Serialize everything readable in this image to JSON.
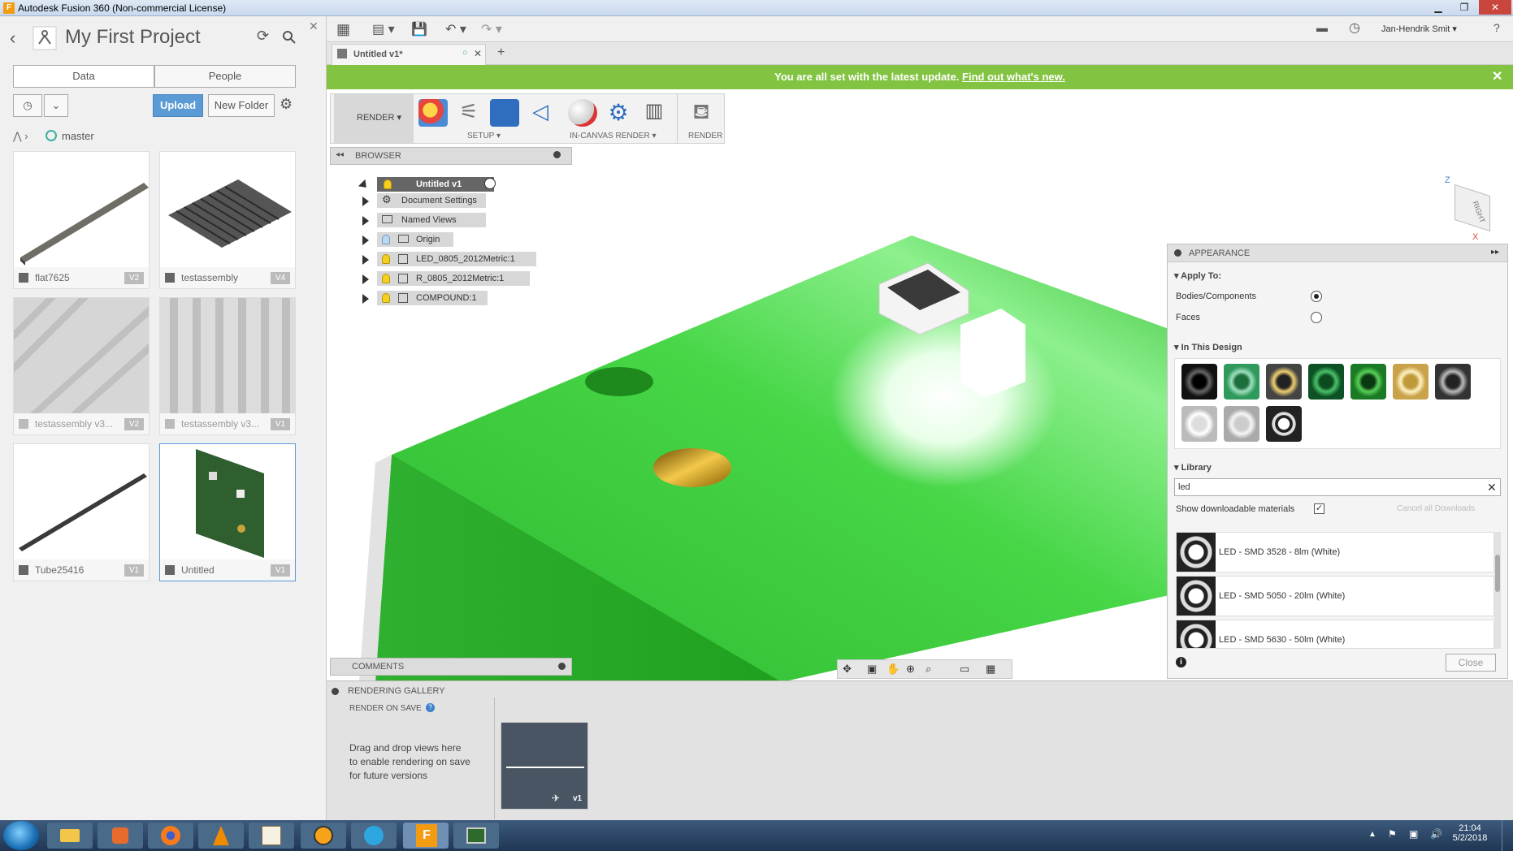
{
  "window": {
    "title": "Autodesk Fusion 360 (Non-commercial License)",
    "app_icon": "F"
  },
  "data_panel": {
    "project_title": "My First Project",
    "tabs": [
      {
        "label": "Data"
      },
      {
        "label": "People"
      }
    ],
    "upload_label": "Upload",
    "new_folder_label": "New Folder",
    "branch": "master",
    "cards": [
      {
        "name": "flat7625",
        "version": "V2"
      },
      {
        "name": "testassembly",
        "version": "V4"
      },
      {
        "name": "testassembly v3...",
        "version": "V2"
      },
      {
        "name": "testassembly v3...",
        "version": "V1"
      },
      {
        "name": "Tube25416",
        "version": "V1"
      },
      {
        "name": "Untitled",
        "version": "V1"
      }
    ]
  },
  "top_bar": {
    "user_name": "Jan-Hendrik Smit"
  },
  "doc_tab": {
    "title": "Untitled v1*",
    "add_label": "+"
  },
  "banner": {
    "text": "You are all set with the latest update.",
    "link": "Find out what's new."
  },
  "toolbar": {
    "workspace": "RENDER",
    "setup_label": "SETUP",
    "incanvas_label": "IN-CANVAS RENDER",
    "render_label": "RENDER"
  },
  "browser": {
    "title": "BROWSER",
    "root": "Untitled v1",
    "items": [
      {
        "label": "Document Settings"
      },
      {
        "label": "Named Views"
      },
      {
        "label": "Origin"
      },
      {
        "label": "LED_0805_2012Metric:1"
      },
      {
        "label": "R_0805_2012Metric:1"
      },
      {
        "label": "COMPOUND:1"
      }
    ]
  },
  "comments": {
    "title": "COMMENTS"
  },
  "appearance": {
    "title": "APPEARANCE",
    "apply_to_title": "Apply To:",
    "option_bodies": "Bodies/Components",
    "option_faces": "Faces",
    "in_design_title": "In This Design",
    "library_title": "Library",
    "search_value": "led",
    "show_downloadable": "Show downloadable materials",
    "cancel_downloads": "Cancel all Downloads",
    "library_items": [
      {
        "label": "LED - SMD 3528 - 8lm (White)"
      },
      {
        "label": "LED - SMD 5050 - 20lm (White)"
      },
      {
        "label": "LED - SMD 5630 - 50lm (White)"
      }
    ],
    "close_label": "Close"
  },
  "gallery": {
    "title": "RENDERING GALLERY",
    "render_on_save": "RENDER ON SAVE",
    "hint_line1": "Drag and drop views here",
    "hint_line2": "to enable rendering on save",
    "hint_line3": "for future versions",
    "thumb_version": "v1"
  },
  "view_cube": {
    "face": "RIGHT",
    "axis_z": "Z",
    "axis_x": "X"
  },
  "taskbar": {
    "time": "21:04",
    "date": "5/2/2018"
  }
}
